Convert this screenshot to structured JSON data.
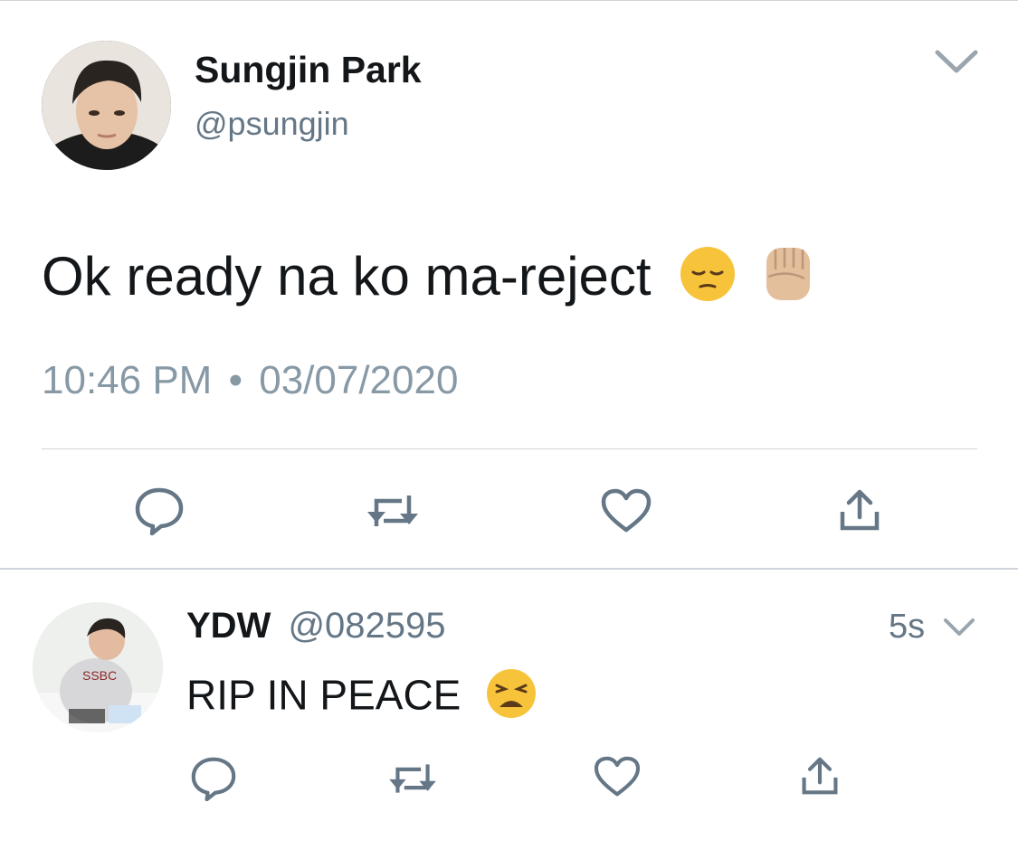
{
  "main_tweet": {
    "display_name": "Sungjin Park",
    "handle": "@psungjin",
    "text": "Ok ready na ko ma-reject",
    "emojis": [
      "pensive-face-emoji",
      "raised-fist-emoji"
    ],
    "time": "10:46 PM",
    "separator": "•",
    "date": "03/07/2020",
    "actions": [
      "reply-icon",
      "retweet-icon",
      "like-icon",
      "share-icon"
    ]
  },
  "reply": {
    "display_name": "YDW",
    "handle": "@082595",
    "time_ago": "5s",
    "text": "RIP IN PEACE",
    "emojis": [
      "weary-face-emoji"
    ],
    "actions": [
      "reply-icon",
      "retweet-icon",
      "like-icon",
      "share-icon"
    ]
  },
  "colors": {
    "text_primary": "#14171a",
    "text_secondary": "#657786",
    "icon": "#657786",
    "divider": "#cfd5da"
  }
}
